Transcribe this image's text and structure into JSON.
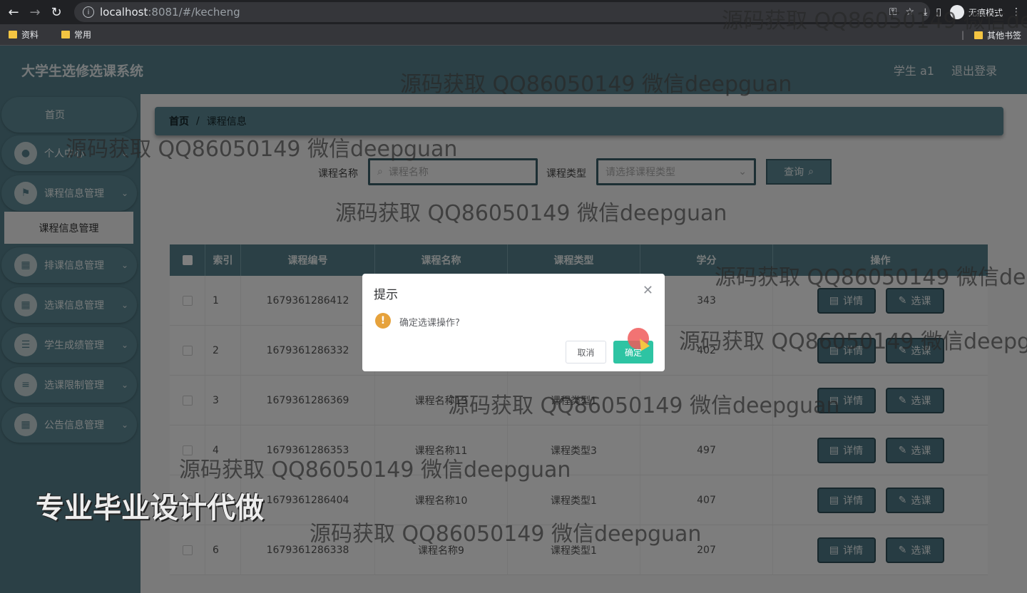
{
  "browser": {
    "url_host": "localhost",
    "url_rest": ":8081/#/kecheng",
    "incognito_label": "无痕模式",
    "bookmarks": [
      "资料",
      "常用"
    ],
    "other_bookmarks": "其他书签"
  },
  "app": {
    "title": "大学生选修选课系统",
    "user": "学生 a1",
    "logout": "退出登录"
  },
  "sidebar": {
    "home": "首页",
    "items": [
      {
        "label": "个人中心",
        "icon": "user-icon"
      },
      {
        "label": "课程信息管理",
        "icon": "flag-icon"
      },
      {
        "label": "排课信息管理",
        "icon": "grid-icon"
      },
      {
        "label": "选课信息管理",
        "icon": "grid-icon"
      },
      {
        "label": "学生成绩管理",
        "icon": "list-icon"
      },
      {
        "label": "选课限制管理",
        "icon": "sliders-icon"
      },
      {
        "label": "公告信息管理",
        "icon": "grid-icon"
      }
    ],
    "submenu": "课程信息管理"
  },
  "breadcrumb": {
    "home": "首页",
    "sep": "/",
    "current": "课程信息"
  },
  "search": {
    "name_label": "课程名称",
    "name_placeholder": "课程名称",
    "type_label": "课程类型",
    "type_placeholder": "请选择课程类型",
    "query_button": "查询"
  },
  "table": {
    "headers": [
      "索引",
      "课程编号",
      "课程名称",
      "课程类型",
      "学分",
      "操作"
    ],
    "rows": [
      {
        "index": "1",
        "code": "1679361286412",
        "name": "",
        "type": "",
        "credit": "343"
      },
      {
        "index": "2",
        "code": "1679361286332",
        "name": "",
        "type": "",
        "credit": "402"
      },
      {
        "index": "3",
        "code": "1679361286369",
        "name": "课程名称13",
        "type": "课程类型1",
        "credit": ""
      },
      {
        "index": "4",
        "code": "1679361286353",
        "name": "课程名称11",
        "type": "课程类型3",
        "credit": "497"
      },
      {
        "index": "",
        "code": "1679361286404",
        "name": "课程名称10",
        "type": "课程类型1",
        "credit": "407"
      },
      {
        "index": "6",
        "code": "1679361286338",
        "name": "课程名称9",
        "type": "课程类型1",
        "credit": "207"
      }
    ],
    "detail_button": "详情",
    "select_button": "选课"
  },
  "dialog": {
    "title": "提示",
    "message": "确定选课操作?",
    "cancel": "取消",
    "confirm": "确定"
  },
  "watermarks": {
    "line": "源码获取 QQ86050149 微信deepguan",
    "big": "专业毕业设计代做"
  }
}
